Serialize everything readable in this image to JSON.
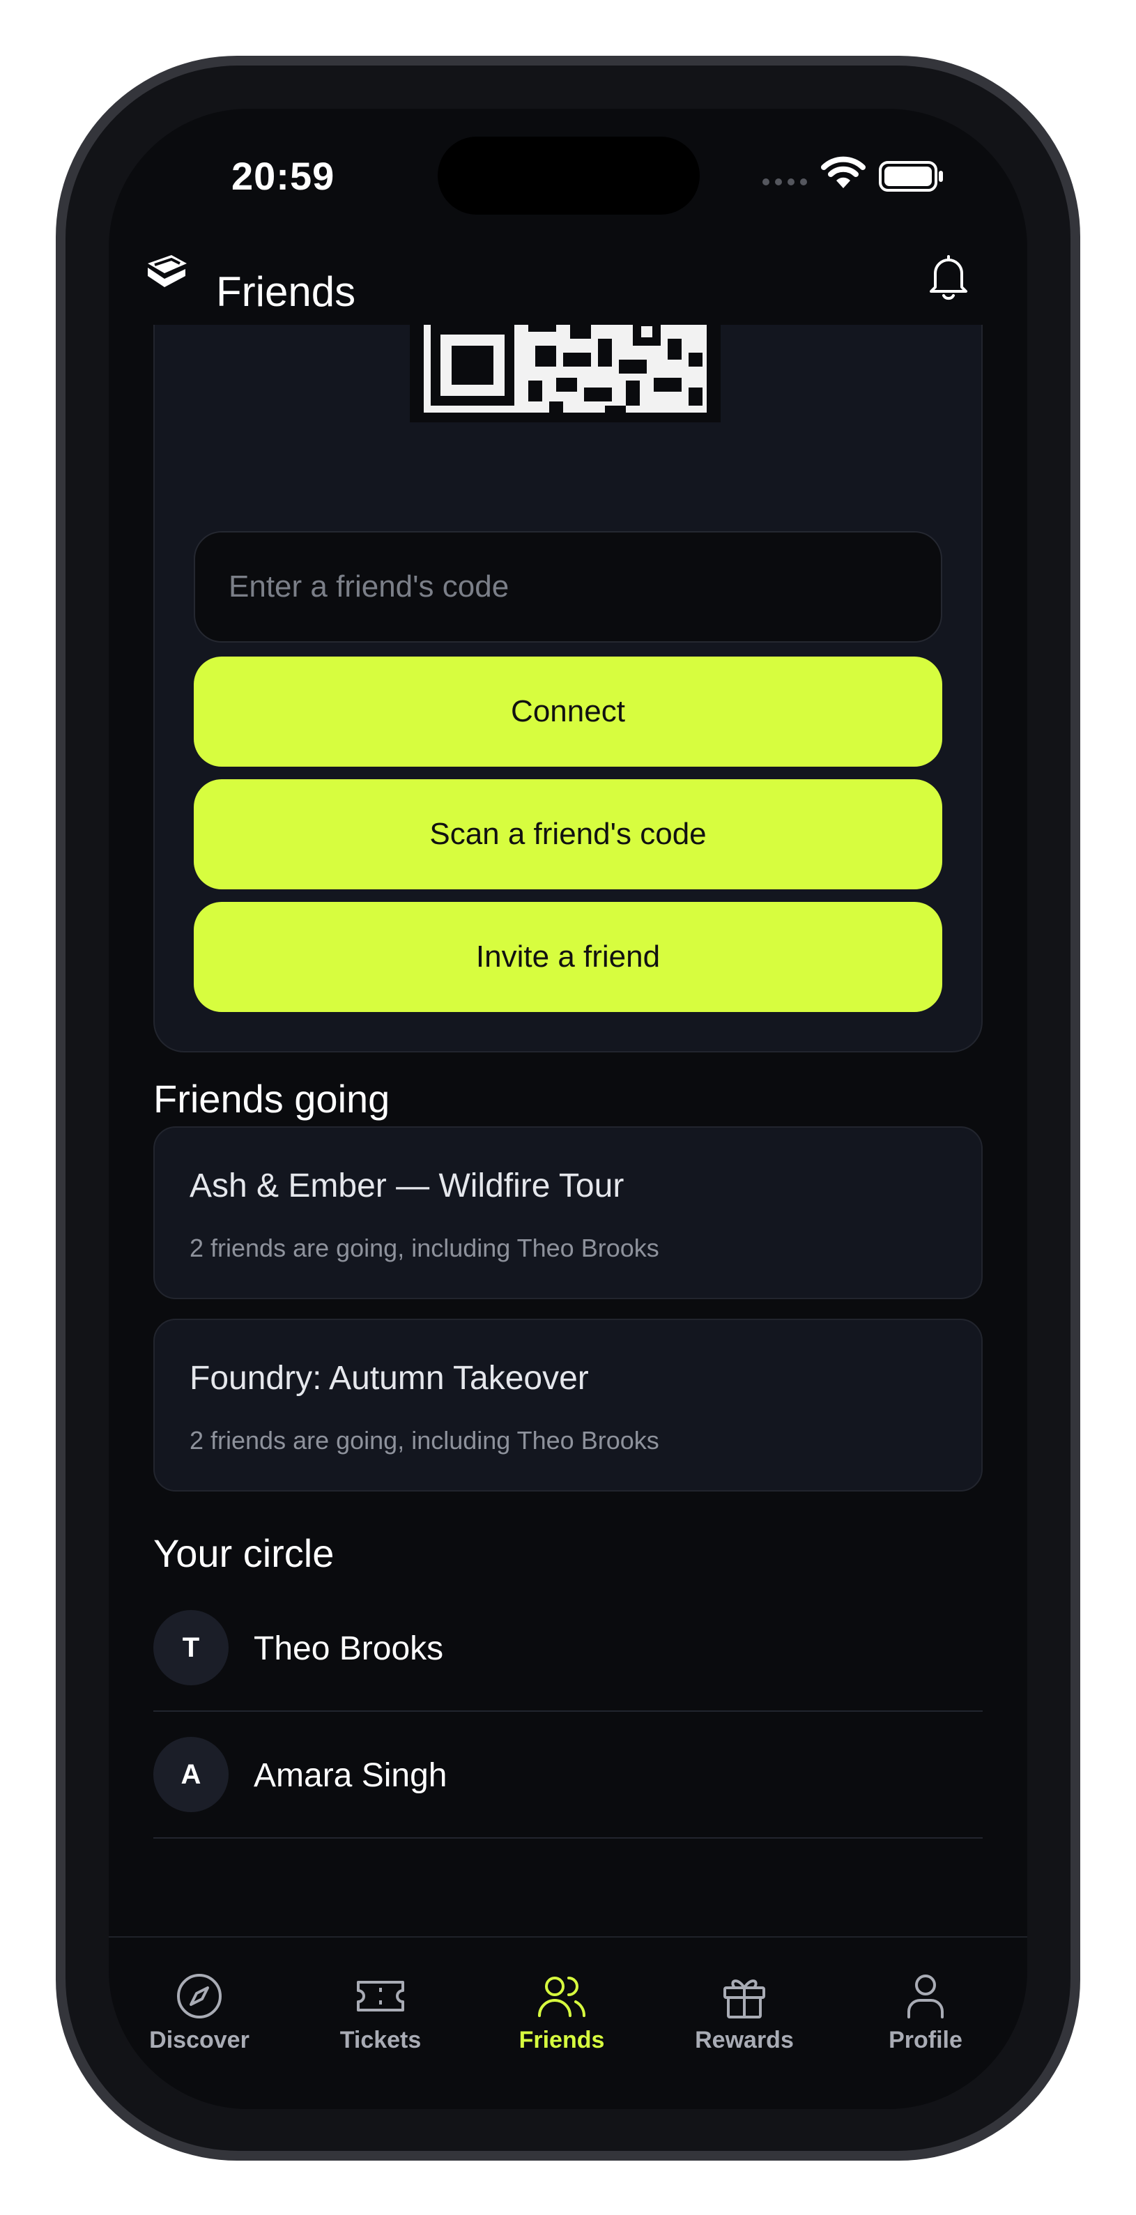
{
  "status_bar": {
    "time": "20:59"
  },
  "header": {
    "title": "Friends",
    "logo_icon": "ticket-logo-icon",
    "bell_icon": "bell-icon"
  },
  "connect": {
    "input_placeholder": "Enter a friend's code",
    "input_value": "",
    "connect_label": "Connect",
    "scan_label": "Scan a friend's code",
    "invite_label": "Invite a friend"
  },
  "friends_going": {
    "title": "Friends going",
    "events": [
      {
        "title": "Ash & Ember — Wildfire Tour",
        "subtitle": "2 friends are going, including Theo Brooks"
      },
      {
        "title": "Foundry: Autumn Takeover",
        "subtitle": "2 friends are going, including Theo Brooks"
      }
    ]
  },
  "circle": {
    "title": "Your circle",
    "friends": [
      {
        "initial": "T",
        "name": "Theo Brooks"
      },
      {
        "initial": "A",
        "name": "Amara Singh"
      }
    ]
  },
  "tabs": [
    {
      "label": "Discover",
      "icon": "compass-icon"
    },
    {
      "label": "Tickets",
      "icon": "ticket-icon"
    },
    {
      "label": "Friends",
      "icon": "friends-icon",
      "active": true
    },
    {
      "label": "Rewards",
      "icon": "gift-icon"
    },
    {
      "label": "Profile",
      "icon": "user-icon"
    }
  ],
  "colors": {
    "accent": "#d7fd3f",
    "background": "#0a0b0e",
    "card": "#13161f"
  }
}
